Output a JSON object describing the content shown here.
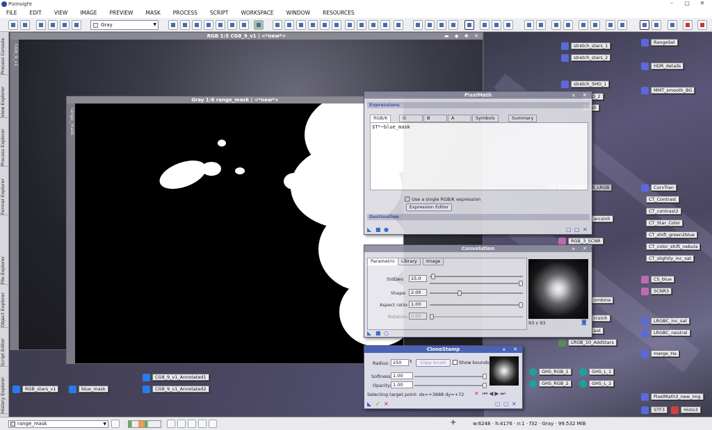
{
  "app": {
    "name": "PixInsight"
  },
  "window_controls": {
    "minimize": "–",
    "maximize": "▢",
    "close": "✕"
  },
  "menu": [
    "FILE",
    "EDIT",
    "VIEW",
    "IMAGE",
    "PREVIEW",
    "MASK",
    "PROCESS",
    "SCRIPT",
    "WORKSPACE",
    "WINDOW",
    "RESOURCES"
  ],
  "toolbar": {
    "channel_select": "Gray"
  },
  "left_dock": {
    "tabs": [
      "Process Console",
      "View Explorer",
      "Process Explorer",
      "Format Explorer",
      "File Explorer",
      "Object Explorer",
      "Script Editor",
      "History Explorer"
    ]
  },
  "image_windows": {
    "rgb": {
      "title": "RGB 1:5 CG8_9_v1 | <*new*>",
      "side_tab": "CG8_9_v1"
    },
    "gray": {
      "title": "Gray 1:6 range_mask | <*new*>",
      "side_tab": "range_mask"
    }
  },
  "pixelmath": {
    "title": "PixelMath",
    "section_expressions": "Expressions",
    "tabs": [
      "RGB/K",
      "G",
      "B",
      "A",
      "Symbols",
      "Summary"
    ],
    "expression": "$T*~blue_mask",
    "use_single_label": "Use a single RGB/K expression",
    "expression_editor_button": "Expression Editor",
    "section_destination": "Destination"
  },
  "convolution": {
    "title": "Convolution",
    "tabs": [
      "Parametric",
      "Library",
      "Image"
    ],
    "stddev_label": "StdDev:",
    "stddev": "15.0",
    "shape_label": "Shape:",
    "shape": "2.00",
    "aspect_label": "Aspect ratio:",
    "aspect": "1.00",
    "rotation_label": "Rotation:",
    "rotation": "0.00",
    "kernel_size": "93 x 93"
  },
  "clonestamp": {
    "title": "CloneStamp",
    "radius_label": "Radius:",
    "radius": "250",
    "copy_brush": "Copy brush",
    "show_bounds": "Show bounds",
    "softness_label": "Softness:",
    "softness": "1.00",
    "opacity_label": "Opacity:",
    "opacity": "1.00",
    "target_point": "Selecting target point: dx=+3888 dy=+72"
  },
  "desktop_icons": {
    "bottom": [
      "RGB_stars_v1",
      "blue_mask",
      "CG8_9_v1_Annotated1",
      "CG8_9_v1_Annotated2"
    ],
    "mid_column": [
      "stretch_stars_1",
      "stretch_stars_2",
      "stretch_SHO_1",
      "SHO_2",
      "h_50",
      "stretch_LINEAR_LRGB",
      "arcsinh",
      "RGB_3_SCNR",
      "ombine",
      "rcsinh",
      "sat",
      "LRGB_10_AddStars",
      "GHS_RGB_1",
      "GHS_L_1",
      "GHS_RGB_2",
      "GHS_L_2"
    ],
    "right_column": [
      "RangeSel",
      "HDR_details",
      "MMT_smooth_BG",
      "CurvTran",
      "CT_Contrast",
      "CT_contrast2",
      "CT_Star_Color",
      "CT_shift_green2blue",
      "CT_color_shift_nebula",
      "CT_slightly_inc_sat",
      "CS_blue",
      "SCNR3",
      "LRGBC_inc_sat",
      "LRGBC_neutral",
      "merge_Ha",
      "PixelMath3_new_img",
      "STF3",
      "Histo3"
    ]
  },
  "status": {
    "view": "range_mask",
    "width": "w:6248",
    "height": "h:4176",
    "channels": "n:1",
    "format": "f32",
    "colorspace": "Gray",
    "memory": "99.532 MiB"
  }
}
